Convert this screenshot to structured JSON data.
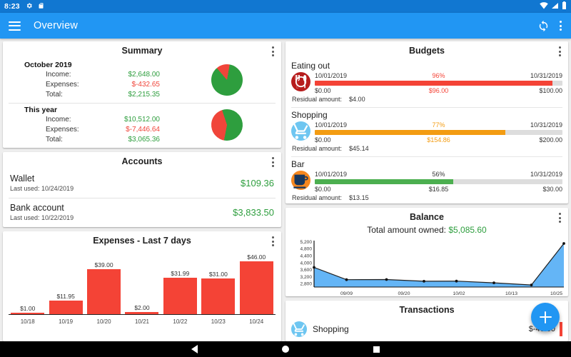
{
  "status_bar": {
    "clock": "8:23",
    "icons": [
      "gear-icon",
      "sd-card-icon",
      "wifi-icon",
      "signal-icon",
      "battery-icon"
    ]
  },
  "app_bar": {
    "title": "Overview",
    "menu_icon": "hamburger-icon",
    "sync_icon": "sync-icon",
    "overflow_icon": "kebab-menu-icon"
  },
  "summary": {
    "title": "Summary",
    "blocks": [
      {
        "period": "October 2019",
        "rows": [
          {
            "label": "Income:",
            "value": "$2,648.00",
            "color": "green"
          },
          {
            "label": "Expenses:",
            "value": "$-432.65",
            "color": "red"
          },
          {
            "label": "Total:",
            "value": "$2,215.35",
            "color": "green"
          }
        ],
        "pie": {
          "green_pct": 86,
          "red_pct": 14
        }
      },
      {
        "period": "This year",
        "rows": [
          {
            "label": "Income:",
            "value": "$10,512.00",
            "color": "green"
          },
          {
            "label": "Expenses:",
            "value": "$-7,446.64",
            "color": "red"
          },
          {
            "label": "Total:",
            "value": "$3,065.36",
            "color": "green"
          }
        ],
        "pie": {
          "green_pct": 58,
          "red_pct": 42
        }
      }
    ]
  },
  "accounts": {
    "title": "Accounts",
    "rows": [
      {
        "name": "Wallet",
        "sub": "Last used: 10/24/2019",
        "amount": "$109.36"
      },
      {
        "name": "Bank account",
        "sub": "Last used: 10/22/2019",
        "amount": "$3,833.50"
      }
    ]
  },
  "expenses_card": {
    "title": "Expenses - Last 7 days"
  },
  "budgets": {
    "title": "Budgets",
    "residual_label": "Residual amount:",
    "items": [
      {
        "name": "Eating out",
        "icon": "restaurant-icon",
        "icon_bg": "#b71c1c",
        "start_date": "10/01/2019",
        "end_date": "10/31/2019",
        "percent_label": "96%",
        "percent": 96,
        "min": "$0.00",
        "spent": "$96.00",
        "max": "$100.00",
        "residual": "$4.00",
        "bar_color": "#f44336",
        "text_color": "#f44336"
      },
      {
        "name": "Shopping",
        "icon": "shopping-cart-icon",
        "icon_bg": "#6ec6f1",
        "start_date": "10/01/2019",
        "end_date": "10/31/2019",
        "percent_label": "77%",
        "percent": 77,
        "min": "$0.00",
        "spent": "$154.86",
        "max": "$200.00",
        "residual": "$45.14",
        "bar_color": "#f39c12",
        "text_color": "#f39c12"
      },
      {
        "name": "Bar",
        "icon": "coffee-cup-icon",
        "icon_bg": "#f5871f",
        "start_date": "10/01/2019",
        "end_date": "10/31/2019",
        "percent_label": "56%",
        "percent": 56,
        "min": "$0.00",
        "spent": "$16.85",
        "max": "$30.00",
        "residual": "$13.15",
        "bar_color": "#4caf50",
        "text_color": "#333333"
      }
    ]
  },
  "balance": {
    "title": "Balance",
    "subtitle_label": "Total amount owned:",
    "subtitle_value": "$5,085.60"
  },
  "transactions": {
    "title": "Transactions",
    "rows": [
      {
        "name": "Shopping",
        "icon": "shopping-icon",
        "amount": "$-46.00"
      }
    ]
  },
  "fab": {
    "icon": "plus-icon",
    "color": "#2196f3"
  },
  "nav_bar": {
    "back": "back-icon",
    "home": "home-icon",
    "recents": "recents-icon"
  },
  "chart_data": [
    {
      "type": "bar",
      "title": "Expenses - Last 7 days",
      "categories": [
        "10/18",
        "10/19",
        "10/20",
        "10/21",
        "10/22",
        "10/23",
        "10/24"
      ],
      "values": [
        1.0,
        11.95,
        39.0,
        2.0,
        31.99,
        31.0,
        46.0
      ],
      "value_labels": [
        "$1.00",
        "$11.95",
        "$39.00",
        "$2.00",
        "$31.99",
        "$31.00",
        "$46.00"
      ],
      "xlabel": "",
      "ylabel": "",
      "ylim": [
        0,
        46
      ],
      "bar_color": "#f44336",
      "grid": false,
      "legend": false
    },
    {
      "type": "area",
      "title": "Balance",
      "x": [
        "09/09",
        "09/20",
        "10/02",
        "10/13",
        "10/25"
      ],
      "x_tick_labels": [
        "09/09",
        "09/20",
        "10/02",
        "10/13",
        "10/25"
      ],
      "y_tick_labels": [
        "2,800",
        "3,200",
        "3,600",
        "4,000",
        "4,400",
        "4,800",
        "5,200"
      ],
      "ylim": [
        2600,
        5200
      ],
      "points": [
        {
          "x": 0.0,
          "y": 3720
        },
        {
          "x": 0.13,
          "y": 3020
        },
        {
          "x": 0.29,
          "y": 3030
        },
        {
          "x": 0.44,
          "y": 2930
        },
        {
          "x": 0.57,
          "y": 2940
        },
        {
          "x": 0.72,
          "y": 2840
        },
        {
          "x": 0.87,
          "y": 2720
        },
        {
          "x": 1.0,
          "y": 5085.6
        }
      ],
      "line_color": "#212121",
      "fill_color": "#64b5f6",
      "grid": false,
      "legend": false
    },
    {
      "type": "pie",
      "title": "October 2019",
      "labels": [
        "Income",
        "Expenses"
      ],
      "values": [
        86,
        14
      ],
      "colors": [
        "#2e9e3e",
        "#f0453a"
      ]
    },
    {
      "type": "pie",
      "title": "This year",
      "labels": [
        "Income",
        "Expenses"
      ],
      "values": [
        58,
        42
      ],
      "colors": [
        "#2e9e3e",
        "#f0453a"
      ]
    }
  ]
}
